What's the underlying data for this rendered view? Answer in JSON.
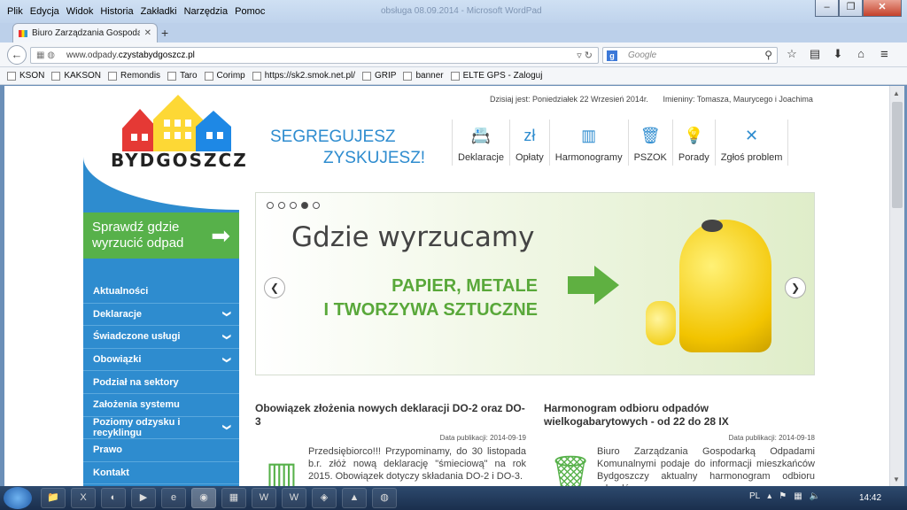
{
  "browser": {
    "menu": [
      "Plik",
      "Edycja",
      "Widok",
      "Historia",
      "Zakładki",
      "Narzędzia",
      "Pomoc"
    ],
    "faded_title": "obsługa 08.09.2014 - Microsoft WordPad",
    "tab_title": "Biuro Zarządzania Gospoda...",
    "url_prefix": "www.odpady.",
    "url_main": "czystabydgoszcz.pl",
    "search_placeholder": "Google",
    "bookmarks": [
      "KSON",
      "KAKSON",
      "Remondis",
      "Taro",
      "Corimp",
      "https://sk2.smok.net.pl/",
      "GRIP",
      "banner",
      "ELTE GPS - Zaloguj"
    ]
  },
  "site": {
    "date_text": "Dzisiaj jest: Poniedziałek 22 Wrzesień 2014r.",
    "names_text": "Imieniny: Tomasza, Maurycego i Joachima",
    "logo_text": "BYDGOSZCZ",
    "slogan_1": "SEGREGUJESZ",
    "slogan_2": "ZYSKUJESZ!",
    "topnav": [
      {
        "label": "Deklaracje",
        "icon": "📇"
      },
      {
        "label": "Opłaty",
        "icon": "zł"
      },
      {
        "label": "Harmonogramy",
        "icon": "▥"
      },
      {
        "label": "PSZOK",
        "icon": "🗑"
      },
      {
        "label": "Porady",
        "icon": "💡"
      },
      {
        "label": "Zgłoś problem",
        "icon": "✕"
      }
    ],
    "cta_label": "Sprawdź gdzie wyrzucić odpad",
    "sidebar": [
      {
        "label": "Aktualności",
        "chev": ""
      },
      {
        "label": "Deklaracje",
        "chev": "❯"
      },
      {
        "label": "Świadczone usługi",
        "chev": "❯"
      },
      {
        "label": "Obowiązki",
        "chev": "❯"
      },
      {
        "label": "Podział na sektory",
        "chev": ""
      },
      {
        "label": "Założenia systemu",
        "chev": ""
      },
      {
        "label": "Poziomy odzysku i recyklingu",
        "chev": "❯"
      },
      {
        "label": "Prawo",
        "chev": ""
      },
      {
        "label": "Kontakt",
        "chev": ""
      }
    ],
    "slider": {
      "headline": "Gdzie wyrzucamy",
      "sub_1": "PAPIER, METALE",
      "sub_2": "I TWORZYWA SZTUCZNE",
      "dots": 5,
      "active_dot": 4
    },
    "news": [
      {
        "title": "Obowiązek złożenia nowych deklaracji DO-2 oraz DO-3",
        "date": "Data publikacji: 2014-09-19",
        "text": "Przedsiębiorco!!! Przypominamy, do 30 listopada b.r. złóż nową deklarację \"śmieciową\" na rok 2015. Obowiązek dotyczy składania DO-2 i DO-3."
      },
      {
        "title": "Harmonogram odbioru odpadów wielkogabarytowych - od 22 do 28 IX",
        "date": "Data publikacji: 2014-09-18",
        "text": "Biuro Zarządzania Gospodarką Odpadami Komunalnymi podaje do informacji mieszkańców Bydgoszczy aktualny harmonogram odbioru odpadów."
      }
    ]
  },
  "taskbar": {
    "tasks": [
      "📁",
      "X",
      "◐",
      "▶",
      "e",
      "◉",
      "▦",
      "W",
      "W",
      "◈",
      "▲",
      "◍"
    ],
    "lang": "PL",
    "time": "14:42"
  }
}
